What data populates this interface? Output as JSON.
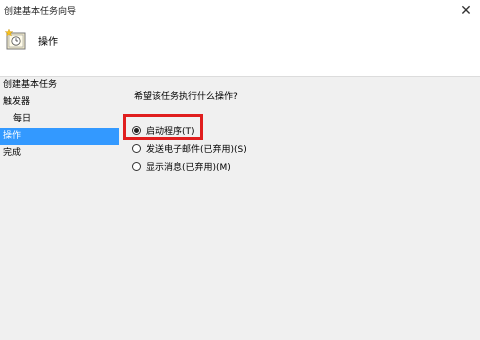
{
  "window": {
    "title": "创建基本任务向导",
    "close_glyph": "✕"
  },
  "header": {
    "title": "操作",
    "icon": "task-clock-icon"
  },
  "sidebar": {
    "items": [
      {
        "label": "创建基本任务",
        "active": false
      },
      {
        "label": "触发器",
        "active": false
      },
      {
        "label": "每日",
        "active": false,
        "sub": true
      },
      {
        "label": "操作",
        "active": true
      },
      {
        "label": "完成",
        "active": false
      }
    ]
  },
  "main": {
    "question": "希望该任务执行什么操作?",
    "options": [
      {
        "label": "启动程序(T)",
        "selected": true
      },
      {
        "label": "发送电子邮件(已弃用)(S)",
        "selected": false
      },
      {
        "label": "显示消息(已弃用)(M)",
        "selected": false
      }
    ],
    "highlight_color": "#e01e1e"
  }
}
